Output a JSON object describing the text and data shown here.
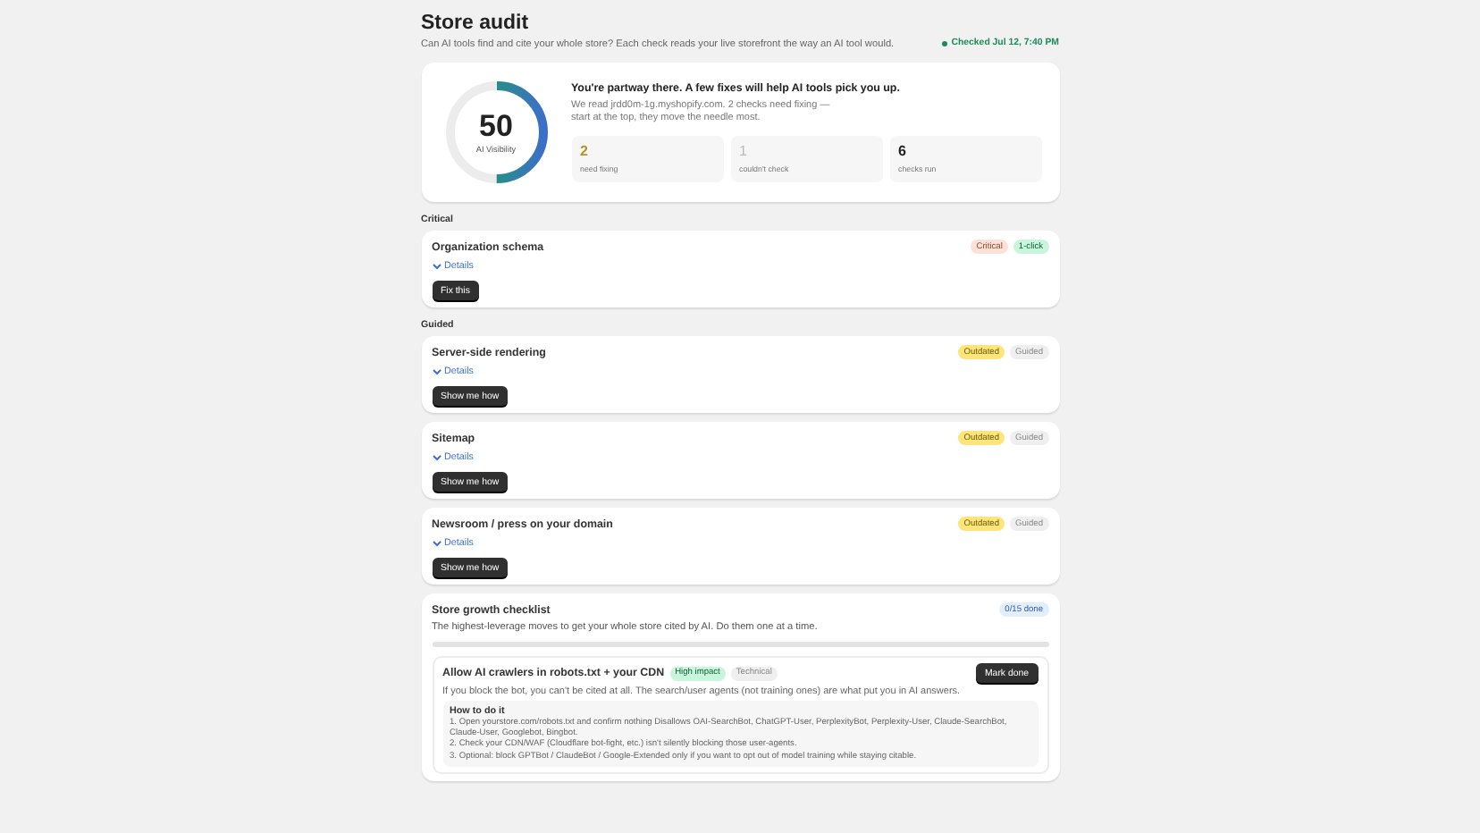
{
  "header": {
    "title": "Store audit",
    "subtitle": "Can AI tools find and cite your whole store? Each check reads your live storefront the way an AI tool would.",
    "status": "Checked Jul 12, 7:40 PM"
  },
  "score": {
    "value": "50",
    "label": "AI Visibility",
    "level": 0.5,
    "headline": "You're partway there. A few fixes will help AI tools pick you up.",
    "text": "We read jrdd0m-1g.myshopify.com. 2 checks need fixing — start at the top, they move the needle most.",
    "stats": [
      {
        "value": "2",
        "label": "need fixing",
        "kind": "warn"
      },
      {
        "value": "1",
        "label": "couldn't check",
        "kind": "muted"
      },
      {
        "value": "6",
        "label": "checks run",
        "kind": "plain"
      }
    ]
  },
  "sections": [
    {
      "title": "Critical",
      "checks": [
        {
          "title": "Organization schema",
          "details": "Details",
          "expanded": false,
          "button": "Fix this",
          "badges": [
            {
              "label": "Critical",
              "kind": "critical"
            },
            {
              "label": "1-click",
              "kind": "good"
            }
          ]
        }
      ]
    },
    {
      "title": "Guided",
      "checks": [
        {
          "title": "Server-side rendering",
          "details": "Details",
          "expanded": false,
          "button": "Show me how",
          "badges": [
            {
              "label": "Outdated",
              "kind": "warn"
            },
            {
              "label": "Guided",
              "kind": "neutral"
            }
          ]
        },
        {
          "title": "Sitemap",
          "details": "Details",
          "expanded": false,
          "button": "Show me how",
          "badges": [
            {
              "label": "Outdated",
              "kind": "warn"
            },
            {
              "label": "Guided",
              "kind": "neutral"
            }
          ]
        },
        {
          "title": "Newsroom / press on your domain",
          "details": "Details",
          "expanded": false,
          "button": "Show me how",
          "badges": [
            {
              "label": "Outdated",
              "kind": "warn"
            },
            {
              "label": "Guided",
              "kind": "neutral"
            }
          ]
        }
      ]
    }
  ],
  "checklist": {
    "title": "Store growth checklist",
    "badge": "0/15 done",
    "text": "The highest-leverage moves to get your whole store cited by AI. Do them one at a time.",
    "level": 0,
    "items": [
      {
        "title": "Allow AI crawlers in robots.txt + your CDN",
        "tags": [
          {
            "label": "High impact",
            "kind": "good"
          },
          {
            "label": "Technical",
            "kind": "neutral"
          }
        ],
        "button": "Mark done",
        "text": "If you block the bot, you can't be cited at all. The search/user agents (not training ones) are what put you in AI answers.",
        "howto_title": "How to do it",
        "steps": [
          "1. Open yourstore.com/robots.txt and confirm nothing Disallows OAI-SearchBot, ChatGPT-User, PerplexityBot, Perplexity-User, Claude-SearchBot, Claude-User, Googlebot, Bingbot.",
          "2. Check your CDN/WAF (Cloudflare bot-fight, etc.) isn't silently blocking those user-agents.",
          "3. Optional: block GPTBot / ClaudeBot / Google-Extended only if you want to opt out of model training while staying citable."
        ]
      }
    ]
  }
}
